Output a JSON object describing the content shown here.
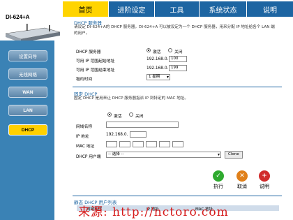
{
  "device": {
    "model": "DI-624+A"
  },
  "sidebar": {
    "items": [
      {
        "label": "设置向导"
      },
      {
        "label": "无线网络"
      },
      {
        "label": "WAN"
      },
      {
        "label": "LAN"
      },
      {
        "label": "DHCP"
      }
    ]
  },
  "tabs": [
    {
      "label": "首页"
    },
    {
      "label": "进阶设定"
    },
    {
      "label": "工具"
    },
    {
      "label": "系统状态"
    },
    {
      "label": "说明"
    }
  ],
  "dhcp_server": {
    "heading": "DHCP 服务器",
    "description": "请设定 DI-624+A的 DHCP 服务器，DI-624+A 可以被设定为一个 DHCP 服务器，用来分配 IP 地址给各个 LAN 端的用户。",
    "server_label": "DHCP 服务器",
    "enable_label": "激活",
    "disable_label": "关闭",
    "start_label": "可用 IP 范围起始地址",
    "start_prefix": "192.168.0.",
    "start_value": "100",
    "end_label": "可用 IP 范围结束地址",
    "end_prefix": "192.168.0.",
    "end_value": "199",
    "lease_label": "租约时间",
    "lease_value": "1 星期"
  },
  "static_dhcp": {
    "heading": "固定 DHCP",
    "description": "固定 DHCP 是用来让 DHCP 服务器指派 IP 到特定的 MAC 地址。",
    "enable_label": "激活",
    "disable_label": "关闭",
    "name_label": "网域名称",
    "ip_label": "IP 地址",
    "ip_prefix": "192.168.0.",
    "mac_label": "MAC 地址",
    "client_label": "DHCP 用户端",
    "client_value": "-- 选择 --",
    "clone_label": "Clone"
  },
  "actions": {
    "apply": "执行",
    "cancel": "取消",
    "help": "说明"
  },
  "static_list": {
    "heading": "静态 DHCP 用户列表",
    "col_name": "网域名称",
    "col_ip": "IP 地址",
    "col_mac": "MAC 地址"
  },
  "watermark": "来源: http://nctoro.com",
  "colors": {
    "nav_blue": "#3a82b5",
    "tab_blue": "#1d65a2",
    "highlight_yellow": "#ffd400",
    "apply_green": "#2faa2f",
    "cancel_orange": "#e0801a",
    "help_red": "#d12b2b",
    "watermark_red": "#d61b1b"
  }
}
